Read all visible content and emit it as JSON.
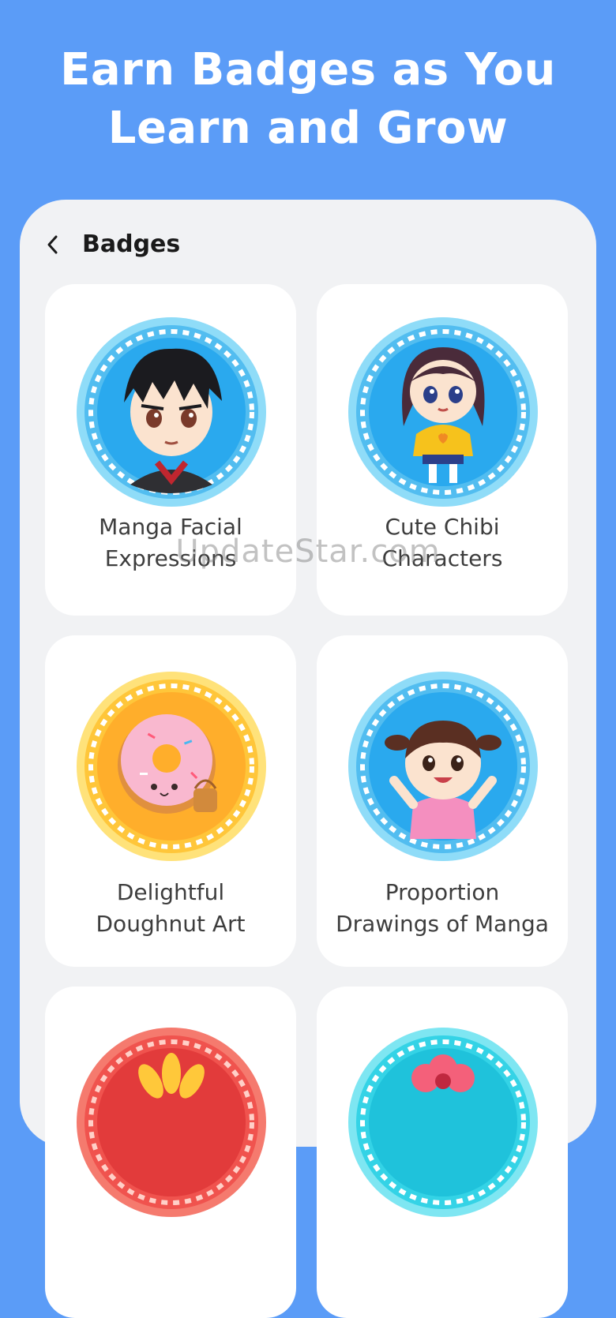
{
  "hero": {
    "line1": "Earn Badges as You",
    "line2": "Learn and Grow"
  },
  "header": {
    "title": "Badges",
    "back_icon": "chevron-left-icon"
  },
  "badges": [
    {
      "line1": "Manga Facial",
      "line2": "Expressions",
      "theme": "blue",
      "art": "manga-boy"
    },
    {
      "line1": "Cute Chibi",
      "line2": "Characters",
      "theme": "blue",
      "art": "chibi-girl"
    },
    {
      "line1": "Delightful",
      "line2": "Doughnut Art",
      "theme": "gold",
      "art": "doughnut"
    },
    {
      "line1": "Proportion",
      "line2": "Drawings of Manga",
      "theme": "blue",
      "art": "cheering-girl"
    },
    {
      "line1": "",
      "line2": "",
      "theme": "red",
      "art": "flower"
    },
    {
      "line1": "",
      "line2": "",
      "theme": "teal",
      "art": "pink-flower"
    }
  ],
  "watermark": "UpdateStar.com",
  "colors": {
    "background": "#5b9cf7",
    "panel": "#f1f2f4",
    "card": "#ffffff",
    "blue_ring": "#7fd6f7",
    "gold_ring": "#ffd65c",
    "red_ring": "#f0534e",
    "teal_ring": "#34d3e6"
  }
}
